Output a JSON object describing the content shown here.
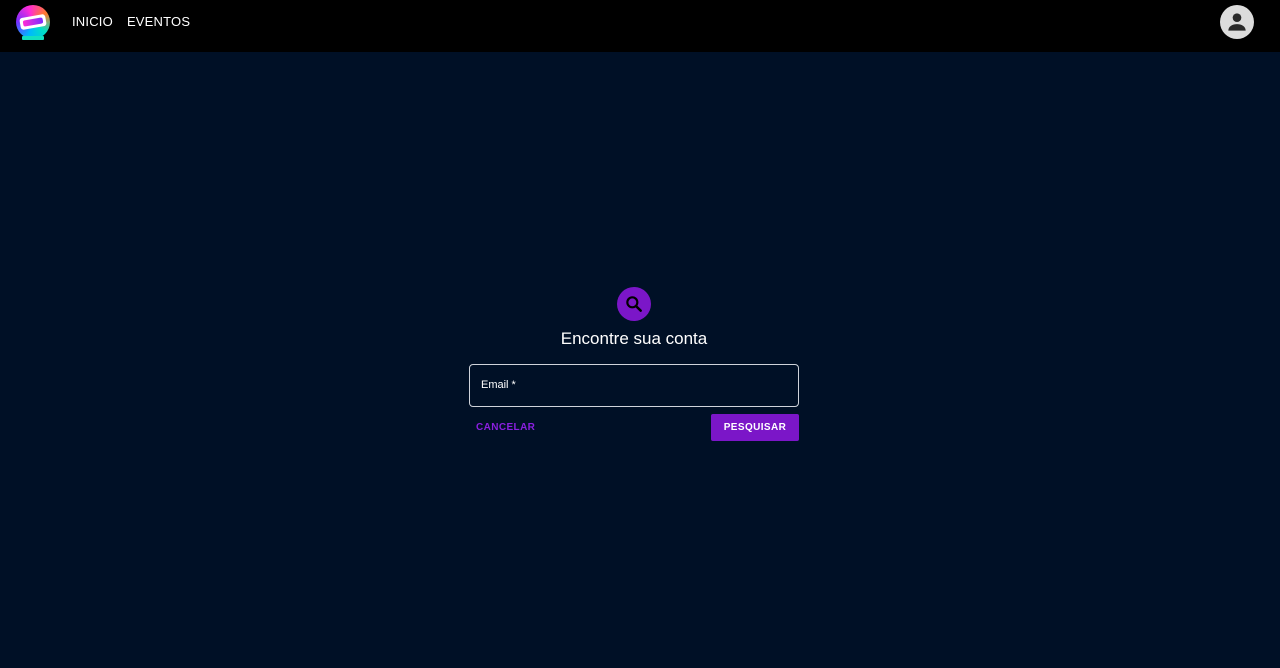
{
  "header": {
    "nav": [
      {
        "label": "INICIO"
      },
      {
        "label": "EVENTOS"
      }
    ]
  },
  "form": {
    "title": "Encontre sua conta",
    "email_label": "Email *",
    "email_value": "",
    "cancel_label": "CANCELAR",
    "submit_label": "PESQUISAR"
  },
  "icons": {
    "logo": "brand-logo-icon",
    "account": "account-circle-icon",
    "search": "search-icon"
  },
  "colors": {
    "background": "#001026",
    "header": "#000000",
    "accent": "#7b16c8",
    "text": "#ffffff"
  }
}
